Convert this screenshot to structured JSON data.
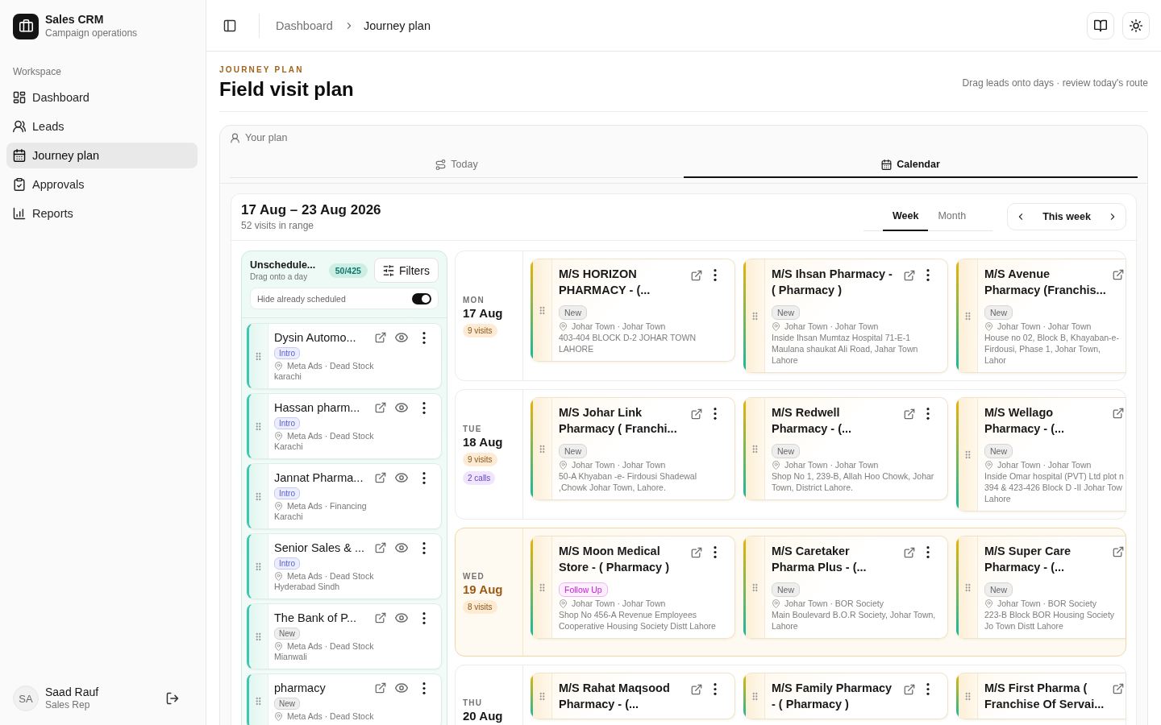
{
  "sidebar": {
    "app_name": "Sales CRM",
    "app_subtitle": "Campaign operations",
    "section": "Workspace",
    "items": [
      {
        "label": "Dashboard",
        "selected": false
      },
      {
        "label": "Leads",
        "selected": false
      },
      {
        "label": "Journey plan",
        "selected": true
      },
      {
        "label": "Approvals",
        "selected": false
      },
      {
        "label": "Reports",
        "selected": false
      }
    ],
    "user": {
      "initials": "SA",
      "name": "Saad Rauf",
      "role": "Sales Rep"
    }
  },
  "header": {
    "breadcrumb": [
      "Dashboard",
      "Journey plan"
    ]
  },
  "page": {
    "eyebrow": "JOURNEY PLAN",
    "title": "Field visit plan",
    "hint": "Drag leads onto days · review today's route"
  },
  "plan": {
    "label": "Your plan",
    "tabs": [
      {
        "label": "Today",
        "selected": false
      },
      {
        "label": "Calendar",
        "selected": true
      }
    ]
  },
  "calendar": {
    "range": "17 Aug – 23 Aug 2026",
    "summary": "52 visits in range",
    "views": [
      {
        "label": "Week",
        "selected": true
      },
      {
        "label": "Month",
        "selected": false
      }
    ],
    "period": "This week",
    "unscheduled": {
      "title": "Unschedule...",
      "subtitle": "Drag onto a day",
      "count": "50/425",
      "filters": "Filters",
      "hide_scheduled": {
        "label": "Hide already scheduled",
        "on": true
      },
      "leads": [
        {
          "name": "Dysin Automo...",
          "tag": {
            "text": "Intro",
            "kind": "intro"
          },
          "source": "Meta Ads · Dead Stock",
          "city": "karachi"
        },
        {
          "name": "Hassan pharm...",
          "tag": {
            "text": "Intro",
            "kind": "intro"
          },
          "source": "Meta Ads · Dead Stock",
          "city": "Karachi"
        },
        {
          "name": "Jannat Pharma...",
          "tag": {
            "text": "Intro",
            "kind": "intro"
          },
          "source": "Meta Ads · Financing",
          "city": "Karachi"
        },
        {
          "name": "Senior Sales & ...",
          "tag": {
            "text": "Intro",
            "kind": "intro"
          },
          "source": "Meta Ads · Dead Stock",
          "city": "Hyderabad Sindh"
        },
        {
          "name": "The Bank of P...",
          "tag": {
            "text": "New",
            "kind": "new"
          },
          "source": "Meta Ads · Dead Stock",
          "city": "Mianwali"
        },
        {
          "name": "pharmacy",
          "tag": {
            "text": "New",
            "kind": "new"
          },
          "source": "Meta Ads · Dead Stock"
        }
      ]
    },
    "days": [
      {
        "weekday": "MON",
        "date": "17 Aug",
        "today": false,
        "badges": [
          {
            "text": "9 visits",
            "kind": "visits"
          }
        ],
        "visits": [
          {
            "name": "M/S HORIZON PHARMACY - (...",
            "tag": {
              "text": "New",
              "kind": "new"
            },
            "area": "Johar Town · Johar Town",
            "address": "403-404 BLOCK D-2 JOHAR TOWN LAHORE",
            "menu": true
          },
          {
            "name": "M/S Ihsan Pharmacy - ( Pharmacy )",
            "tag": {
              "text": "New",
              "kind": "new"
            },
            "area": "Johar Town · Johar Town",
            "address": "Inside Ihsan Mumtaz Hospital 71-E-1 Maulana shaukat Ali Road, Jahar Town Lahore",
            "menu": true
          },
          {
            "name": "M/S Avenue Pharmacy (Franchis...",
            "tag": {
              "text": "New",
              "kind": "new"
            },
            "area": "Johar Town · Johar Town",
            "address": "House no 02, Block B, Khayaban-e- Firdousi, Phase 1, Johar Town, Lahor",
            "menu": false
          }
        ]
      },
      {
        "weekday": "TUE",
        "date": "18 Aug",
        "today": false,
        "badges": [
          {
            "text": "9 visits",
            "kind": "visits"
          },
          {
            "text": "2 calls",
            "kind": "calls"
          }
        ],
        "visits": [
          {
            "name": "M/S Johar Link Pharmacy ( Franchi...",
            "tag": {
              "text": "New",
              "kind": "new"
            },
            "area": "Johar Town · Johar Town",
            "address": "50-A Khyaban -e- Firdousi Shadewal ,Chowk Johar Town, Lahore.",
            "menu": true
          },
          {
            "name": "M/S Redwell Pharmacy - (...",
            "tag": {
              "text": "New",
              "kind": "new"
            },
            "area": "Johar Town · Johar Town",
            "address": "Shop No 1, 239-B, Allah Hoo Chowk, Johar Town, District Lahore.",
            "menu": true
          },
          {
            "name": "M/S Wellago Pharmacy - (...",
            "tag": {
              "text": "New",
              "kind": "new"
            },
            "area": "Johar Town · Johar Town",
            "address": "Inside Omar hospital (PVT) Ltd plot n 394 & 423-426 Block D -II Johar Tow Lahore",
            "menu": false
          }
        ]
      },
      {
        "weekday": "WED",
        "date": "19 Aug",
        "today": true,
        "badges": [
          {
            "text": "8 visits",
            "kind": "visits"
          }
        ],
        "visits": [
          {
            "name": "M/S Moon Medical Store - ( Pharmacy )",
            "tag": {
              "text": "Follow Up",
              "kind": "followup"
            },
            "area": "Johar Town · Johar Town",
            "address": "Shop No 456-A Revenue Employees Cooperative Housing Society Distt Lahore",
            "menu": true
          },
          {
            "name": "M/S Caretaker Pharma Plus - (...",
            "tag": {
              "text": "New",
              "kind": "new"
            },
            "area": "Johar Town · BOR Society",
            "address": "Main Boulevard B.O.R Society, Johar Town, Lahore",
            "menu": true
          },
          {
            "name": "M/S Super Care Pharmacy - (...",
            "tag": {
              "text": "New",
              "kind": "new"
            },
            "area": "Johar Town · BOR Society",
            "address": "223-B Block BOR Housing Society Jo Town Distt Lahore",
            "menu": false
          }
        ]
      },
      {
        "weekday": "THU",
        "date": "20 Aug",
        "today": false,
        "visits": [
          {
            "name": "M/S Rahat Maqsood Pharmacy - (...",
            "menu": true
          },
          {
            "name": "M/S Family Pharmacy - ( Pharmacy )",
            "menu": true
          },
          {
            "name": "M/S First Pharma ( Franchise Of Servai...",
            "menu": false
          }
        ]
      }
    ]
  }
}
